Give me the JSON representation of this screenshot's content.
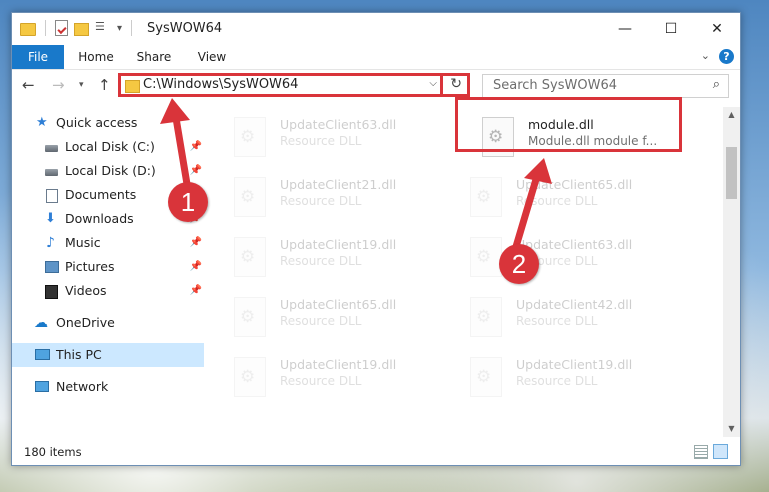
{
  "window": {
    "title": "SysWOW64",
    "controls": {
      "minimize": "—",
      "maximize": "☐",
      "close": "✕"
    }
  },
  "ribbon": {
    "tabs": [
      "File",
      "Home",
      "Share",
      "View"
    ],
    "collapse_icon": "chevron-down-icon",
    "help": "?"
  },
  "nav": {
    "back": "←",
    "forward": "→",
    "recent": "▾",
    "up": "↑",
    "address": "C:\\Windows\\SysWOW64",
    "address_dropdown": "⌵",
    "refresh": "↻",
    "search_placeholder": "Search SysWOW64",
    "search_icon": "⌕"
  },
  "sidebar": {
    "items": [
      {
        "label": "Quick access",
        "icon": "star-icon",
        "pinned": false
      },
      {
        "label": "Local Disk (C:)",
        "icon": "drive-icon",
        "pinned": true
      },
      {
        "label": "Local Disk (D:)",
        "icon": "drive-icon",
        "pinned": true
      },
      {
        "label": "Documents",
        "icon": "documents-icon",
        "pinned": true
      },
      {
        "label": "Downloads",
        "icon": "downloads-icon",
        "pinned": true
      },
      {
        "label": "Music",
        "icon": "music-icon",
        "pinned": true
      },
      {
        "label": "Pictures",
        "icon": "pictures-icon",
        "pinned": true
      },
      {
        "label": "Videos",
        "icon": "videos-icon",
        "pinned": true
      },
      {
        "label": "OneDrive",
        "icon": "onedrive-icon",
        "pinned": false
      },
      {
        "label": "This PC",
        "icon": "pc-icon",
        "pinned": false,
        "selected": true
      },
      {
        "label": "Network",
        "icon": "network-icon",
        "pinned": false
      }
    ]
  },
  "files": {
    "left_column": [
      {
        "name": "UpdateClient63.dll",
        "type": "Resource DLL"
      },
      {
        "name": "UpdateClient21.dll",
        "type": "Resource DLL"
      },
      {
        "name": "UpdateClient19.dll",
        "type": "Resource DLL"
      },
      {
        "name": "UpdateClient65.dll",
        "type": "Resource DLL"
      },
      {
        "name": "UpdateClient19.dll",
        "type": "Resource DLL"
      }
    ],
    "right_column": [
      {
        "name": "module.dll",
        "type": "Module.dll module f...",
        "highlighted": true
      },
      {
        "name": "UpdateClient65.dll",
        "type": "Resource DLL"
      },
      {
        "name": "UpdateClient63.dll",
        "type": "Resource DLL"
      },
      {
        "name": "UpdateClient42.dll",
        "type": "Resource DLL"
      },
      {
        "name": "UpdateClient19.dll",
        "type": "Resource DLL"
      }
    ]
  },
  "status": {
    "item_count": "180 items"
  },
  "annotations": {
    "badge1": "1",
    "badge2": "2",
    "accent_color": "#d9343a"
  },
  "colors": {
    "file_tab": "#1979ca",
    "selection": "#cce8ff"
  }
}
